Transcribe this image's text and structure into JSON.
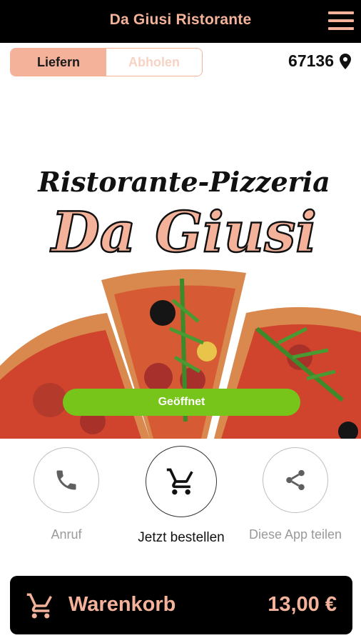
{
  "header": {
    "title": "Da Giusi Ristorante"
  },
  "order_mode": {
    "delivery": "Liefern",
    "pickup": "Abholen"
  },
  "location": {
    "zip": "67136"
  },
  "hero": {
    "line1": "Ristorante-Pizzeria",
    "line2": "Da Giusi"
  },
  "status": {
    "label": "Geöffnet"
  },
  "actions": {
    "call": "Anruf",
    "order": "Jetzt bestellen",
    "share": "Diese App teilen"
  },
  "cart": {
    "label": "Warenkorb",
    "total": "13,00 €"
  },
  "colors": {
    "accent": "#f5b29a",
    "status_green": "#77c41b",
    "bar_black": "#000000"
  }
}
